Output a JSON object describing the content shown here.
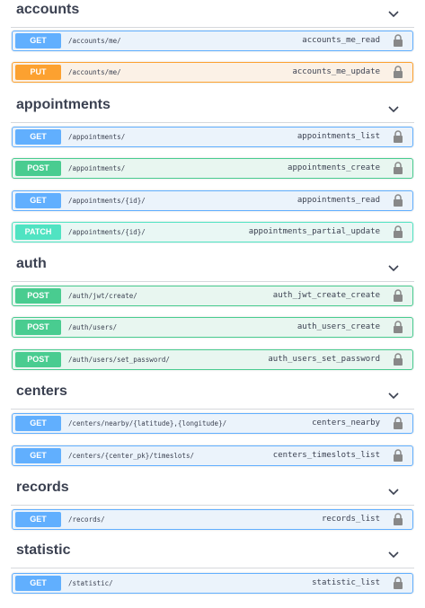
{
  "groups": [
    {
      "title": "accounts",
      "ops": [
        {
          "method": "GET",
          "path": "/accounts/me/",
          "id": "accounts_me_read"
        },
        {
          "method": "PUT",
          "path": "/accounts/me/",
          "id": "accounts_me_update"
        }
      ]
    },
    {
      "title": "appointments",
      "ops": [
        {
          "method": "GET",
          "path": "/appointments/",
          "id": "appointments_list"
        },
        {
          "method": "POST",
          "path": "/appointments/",
          "id": "appointments_create"
        },
        {
          "method": "GET",
          "path": "/appointments/{id}/",
          "id": "appointments_read"
        },
        {
          "method": "PATCH",
          "path": "/appointments/{id}/",
          "id": "appointments_partial_update"
        }
      ]
    },
    {
      "title": "auth",
      "ops": [
        {
          "method": "POST",
          "path": "/auth/jwt/create/",
          "id": "auth_jwt_create_create"
        },
        {
          "method": "POST",
          "path": "/auth/users/",
          "id": "auth_users_create"
        },
        {
          "method": "POST",
          "path": "/auth/users/set_password/",
          "id": "auth_users_set_password"
        }
      ]
    },
    {
      "title": "centers",
      "ops": [
        {
          "method": "GET",
          "path": "/centers/nearby/{latitude},{longitude}/",
          "id": "centers_nearby"
        },
        {
          "method": "GET",
          "path": "/centers/{center_pk}/timeslots/",
          "id": "centers_timeslots_list"
        }
      ]
    },
    {
      "title": "records",
      "ops": [
        {
          "method": "GET",
          "path": "/records/",
          "id": "records_list"
        }
      ]
    },
    {
      "title": "statistic",
      "ops": [
        {
          "method": "GET",
          "path": "/statistic/",
          "id": "statistic_list"
        }
      ]
    }
  ],
  "icons": {
    "expand": "chevron-down-icon",
    "auth": "lock-icon"
  },
  "colors": {
    "get": "#61affe",
    "put": "#fca130",
    "post": "#49cc90",
    "patch": "#50e3c2",
    "text": "#3b4151"
  }
}
